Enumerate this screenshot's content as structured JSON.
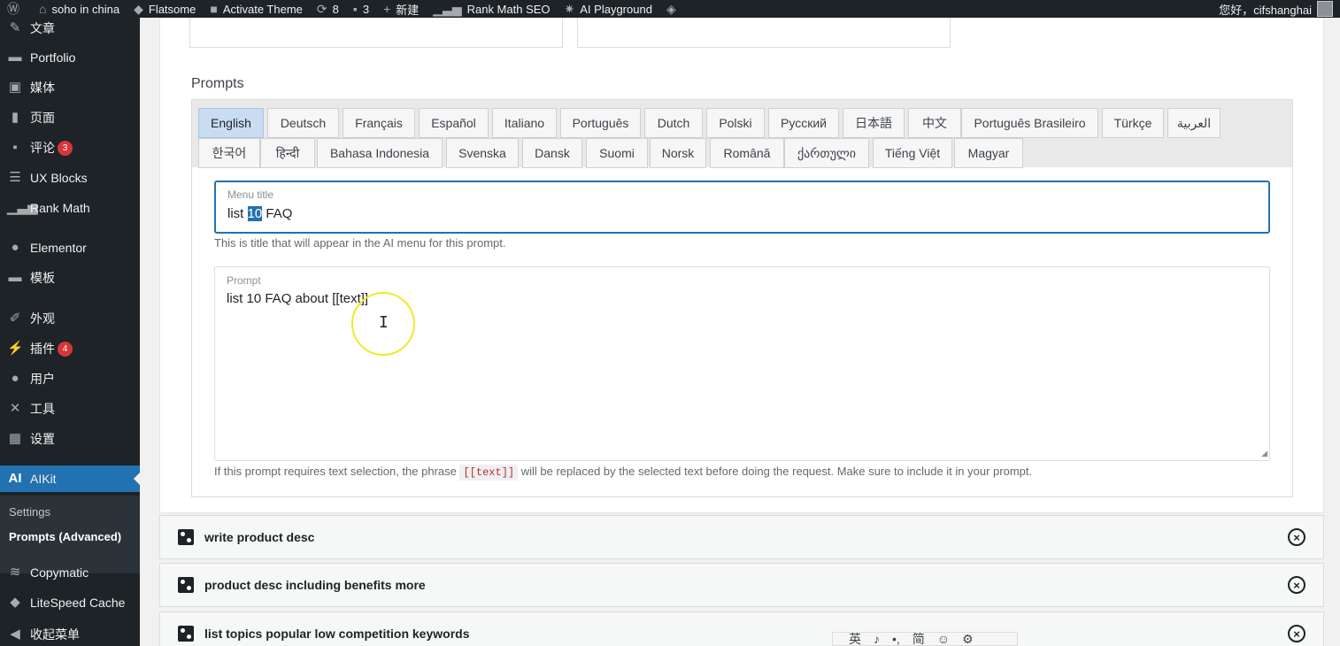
{
  "adminbar": {
    "site_name": "soho in china",
    "theme": "Flatsome",
    "activate_theme": "Activate Theme",
    "updates_count": "8",
    "comments_count": "3",
    "new_label": "新建",
    "rankmath": "Rank Math SEO",
    "ai_playground": "AI Playground",
    "greeting": "您好，cifshanghai"
  },
  "sidebar": {
    "items": [
      {
        "label": "文章",
        "icon": "pin-icon"
      },
      {
        "label": "Portfolio",
        "icon": "folder-icon"
      },
      {
        "label": "媒体",
        "icon": "media-icon"
      },
      {
        "label": "页面",
        "icon": "page-icon"
      },
      {
        "label": "评论",
        "icon": "comment-icon",
        "badge": "3"
      },
      {
        "label": "UX Blocks",
        "icon": "blocks-icon"
      },
      {
        "label": "Rank Math",
        "icon": "chart-icon"
      },
      {
        "label": "Elementor",
        "icon": "elementor-icon"
      },
      {
        "label": "模板",
        "icon": "folder-icon"
      },
      {
        "label": "外观",
        "icon": "brush-icon"
      },
      {
        "label": "插件",
        "icon": "plugin-icon",
        "badge": "4"
      },
      {
        "label": "用户",
        "icon": "user-icon"
      },
      {
        "label": "工具",
        "icon": "wrench-icon"
      },
      {
        "label": "设置",
        "icon": "settings-icon"
      },
      {
        "label": "AIKit",
        "icon": "ai-icon"
      },
      {
        "label": "Copymatic",
        "icon": "stack-icon"
      },
      {
        "label": "LiteSpeed Cache",
        "icon": "diamond-icon"
      },
      {
        "label": "收起菜单",
        "icon": "collapse-icon"
      }
    ],
    "submenu": [
      "Settings",
      "Prompts (Advanced)"
    ]
  },
  "main": {
    "prompts_heading": "Prompts",
    "tabs_row1": [
      "English",
      "Deutsch",
      "Français",
      "Español",
      "Italiano",
      "Português",
      "Dutch",
      "Polski",
      "Русский",
      "日本語",
      "中文",
      "Português Brasileiro",
      "Türkçe",
      "العربية"
    ],
    "tabs_row2": [
      "한국어",
      "हिन्दी",
      "Bahasa Indonesia",
      "Svenska",
      "Dansk",
      "Suomi",
      "Norsk",
      "Română",
      "ქართული",
      "Tiếng Việt",
      "Magyar"
    ],
    "active_tab": "English",
    "menu_title": {
      "label": "Menu title",
      "value_before": "list ",
      "value_selected": "10",
      "value_after": " FAQ",
      "help": "This is title that will appear in the AI menu for this prompt."
    },
    "prompt": {
      "label": "Prompt",
      "value": "list 10 FAQ about [[text]]",
      "help_before": "If this prompt requires text selection, the phrase",
      "help_code": "[[text]]",
      "help_after": "will be replaced by the selected text before doing the request. Make sure to include it in your prompt."
    }
  },
  "prompt_list": [
    "write product desc",
    "product desc including benefits more",
    "list topics popular low competition keywords"
  ],
  "ime_toolbar": [
    "英",
    "♪",
    "•,",
    "简",
    "☺",
    "⚙"
  ]
}
